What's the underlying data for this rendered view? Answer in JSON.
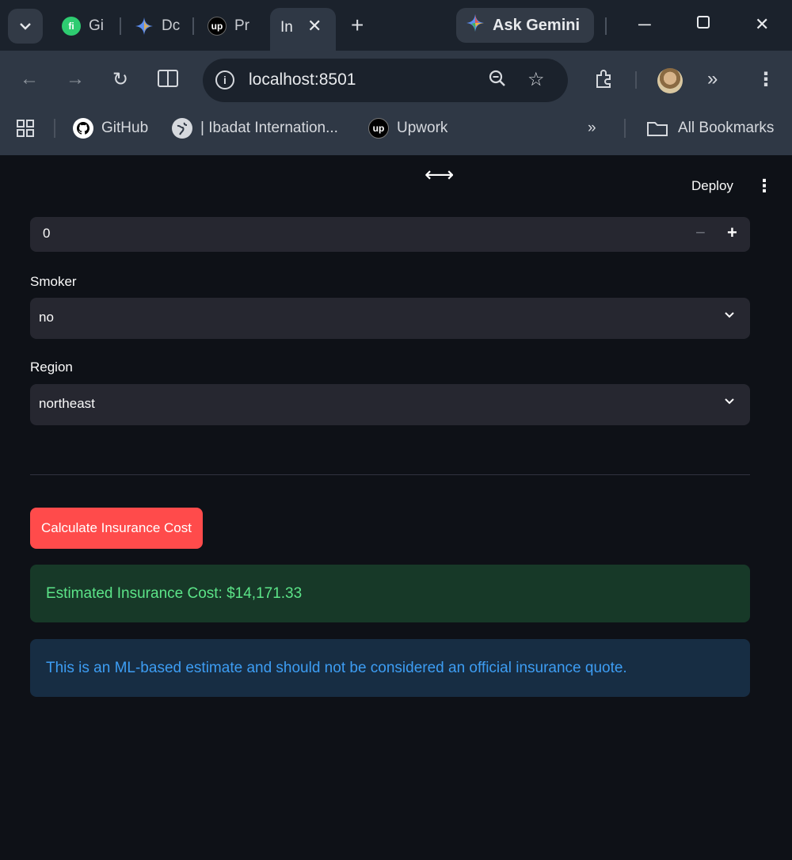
{
  "browser": {
    "tabs": [
      {
        "label": "Gi",
        "favicon": "fi-favicon"
      },
      {
        "label": "Dc",
        "favicon": "gemini-favicon"
      },
      {
        "label": "Pr",
        "favicon": "upwork-favicon"
      },
      {
        "label": "In",
        "active": true
      }
    ],
    "ask_gemini_label": "Ask Gemini",
    "address": "localhost:8501",
    "bookmarks": [
      {
        "label": "GitHub"
      },
      {
        "label": "| Ibadat Internation..."
      },
      {
        "label": "Upwork"
      }
    ],
    "all_bookmarks_label": "All Bookmarks"
  },
  "app": {
    "deploy_label": "Deploy",
    "number_input": {
      "value": "0"
    },
    "smoker": {
      "label": "Smoker",
      "value": "no"
    },
    "region": {
      "label": "Region",
      "value": "northeast"
    },
    "calculate_button_label": "Calculate Insurance Cost",
    "result_message": "Estimated Insurance Cost: $14,171.33",
    "disclaimer": "This is an ML-based estimate and should not be considered an official insurance quote."
  },
  "colors": {
    "primary_button": "#ff4b4b",
    "success_bg": "#173928",
    "success_text": "#5ce488",
    "info_bg": "#172d43",
    "info_text": "#3d9df3",
    "app_bg": "#0e1117"
  }
}
